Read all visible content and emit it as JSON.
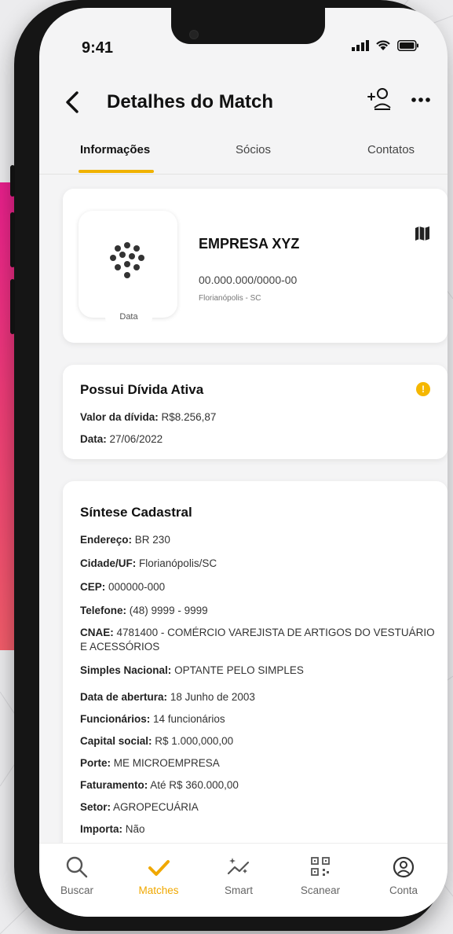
{
  "status": {
    "time": "9:41"
  },
  "header": {
    "title": "Detalhes do Match"
  },
  "tabs": [
    {
      "label": "Informações",
      "active": true
    },
    {
      "label": "Sócios",
      "active": false
    },
    {
      "label": "Contatos",
      "active": false
    }
  ],
  "company": {
    "name": "EMPRESA XYZ",
    "cnpj": "00.000.000/0000-00",
    "city": "Florianópolis - SC",
    "logo_label": "Data"
  },
  "debt": {
    "title": "Possui Dívida Ativa",
    "value_label": "Valor da dívida:",
    "value": "R$8.256,87",
    "date_label": "Data:",
    "date": "27/06/2022"
  },
  "synthesis": {
    "title": "Síntese Cadastral",
    "rows": [
      {
        "label": "Endereço:",
        "value": "BR 230"
      },
      {
        "label": "Cidade/UF:",
        "value": "Florianópolis/SC"
      },
      {
        "label": "CEP:",
        "value": "000000-000"
      },
      {
        "label": "Telefone:",
        "value": "(48) 9999 - 9999"
      },
      {
        "label": "CNAE:",
        "value": "4781400 - COMÉRCIO VAREJISTA DE ARTIGOS DO VESTUÁRIO E ACESSÓRIOS"
      },
      {
        "label": "Simples Nacional:",
        "value": "OPTANTE PELO SIMPLES"
      },
      {
        "label": "Data de abertura:",
        "value": "18 Junho de 2003"
      },
      {
        "label": "Funcionários:",
        "value": "14 funcionários"
      },
      {
        "label": "Capital social:",
        "value": "R$ 1.000,000,00"
      },
      {
        "label": "Porte:",
        "value": "ME MICROEMPRESA"
      },
      {
        "label": "Faturamento:",
        "value": "Até R$ 360.000,00"
      },
      {
        "label": "Setor:",
        "value": "AGROPECUÁRIA"
      },
      {
        "label": "Importa:",
        "value": "Não"
      }
    ]
  },
  "nav": [
    {
      "label": "Buscar",
      "icon": "search-icon",
      "active": false
    },
    {
      "label": "Matches",
      "icon": "check-icon",
      "active": true
    },
    {
      "label": "Smart",
      "icon": "sparkle-chart-icon",
      "active": false
    },
    {
      "label": "Scanear",
      "icon": "qr-scan-icon",
      "active": false
    },
    {
      "label": "Conta",
      "icon": "user-circle-icon",
      "active": false
    }
  ],
  "colors": {
    "accent": "#f0b200",
    "pink": "#e81f8c",
    "info": "#f5b700"
  }
}
